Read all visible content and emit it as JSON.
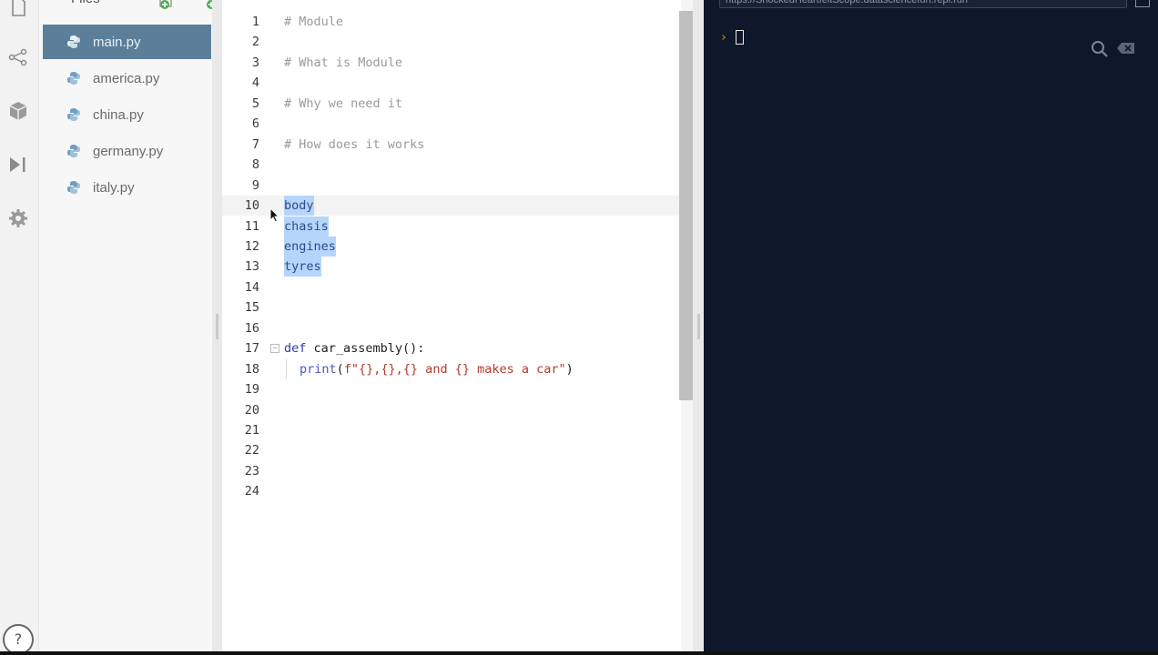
{
  "rail": {
    "icons": [
      "file-icon",
      "share-icon",
      "package-icon",
      "run-icon",
      "settings-icon"
    ],
    "help_label": "?"
  },
  "files": {
    "header": "Files",
    "items": [
      {
        "name": "main.py",
        "active": true
      },
      {
        "name": "america.py",
        "active": false
      },
      {
        "name": "china.py",
        "active": false
      },
      {
        "name": "germany.py",
        "active": false
      },
      {
        "name": "italy.py",
        "active": false
      }
    ]
  },
  "editor": {
    "lines": [
      {
        "n": "1",
        "text": "# Module"
      },
      {
        "n": "2",
        "text": ""
      },
      {
        "n": "3",
        "text": "# What is Module"
      },
      {
        "n": "4",
        "text": ""
      },
      {
        "n": "5",
        "text": "# Why we need it"
      },
      {
        "n": "6",
        "text": ""
      },
      {
        "n": "7",
        "text": "# How does it works"
      },
      {
        "n": "8",
        "text": ""
      },
      {
        "n": "9",
        "text": ""
      },
      {
        "n": "10",
        "text": "body"
      },
      {
        "n": "11",
        "text": "chasis"
      },
      {
        "n": "12",
        "text": "engines"
      },
      {
        "n": "13",
        "text": "tyres"
      },
      {
        "n": "14",
        "text": ""
      },
      {
        "n": "15",
        "text": ""
      },
      {
        "n": "16",
        "text": ""
      },
      {
        "n": "17",
        "kw": "def",
        "fn": " car_assembly():"
      },
      {
        "n": "18",
        "builtin": "print",
        "open": "(",
        "str": "f\"{},{},{} and {} makes a car\"",
        "close": ")"
      },
      {
        "n": "19",
        "text": ""
      },
      {
        "n": "20",
        "text": ""
      },
      {
        "n": "21",
        "text": ""
      },
      {
        "n": "22",
        "text": ""
      },
      {
        "n": "23",
        "text": ""
      },
      {
        "n": "24",
        "text": ""
      }
    ]
  },
  "console": {
    "url": "https://ShockedHeartfeltScope.datasciencefun.repl.run",
    "prompt": "›",
    "colors": {
      "background": "#0f172a",
      "prompt": "#f28c1c"
    }
  },
  "colors": {
    "active_file_bg": "#5b7f99",
    "selection": "#b5d5fb"
  }
}
